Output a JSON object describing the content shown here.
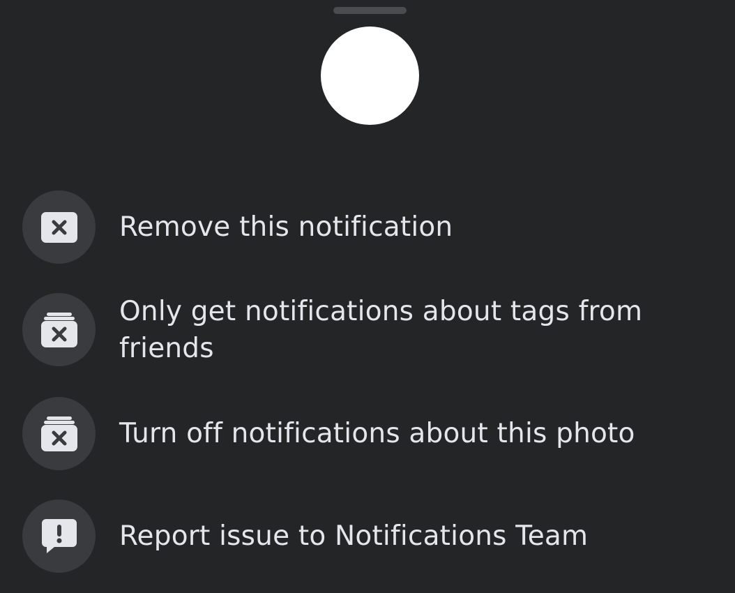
{
  "sheet": {
    "menu_items": [
      {
        "label": "Remove this notification",
        "icon": "close-box-icon"
      },
      {
        "label": "Only get notifications about tags from friends",
        "icon": "stack-close-icon"
      },
      {
        "label": "Turn off notifications about this photo",
        "icon": "stack-close-icon"
      },
      {
        "label": "Report issue to Notifications Team",
        "icon": "report-exclamation-icon"
      }
    ]
  },
  "colors": {
    "background": "#242527",
    "icon_circle": "#3a3b3e",
    "icon_glyph": "#e4e6eb",
    "text": "#e4e6eb",
    "handle": "#4a4c50",
    "avatar": "#ffffff"
  }
}
